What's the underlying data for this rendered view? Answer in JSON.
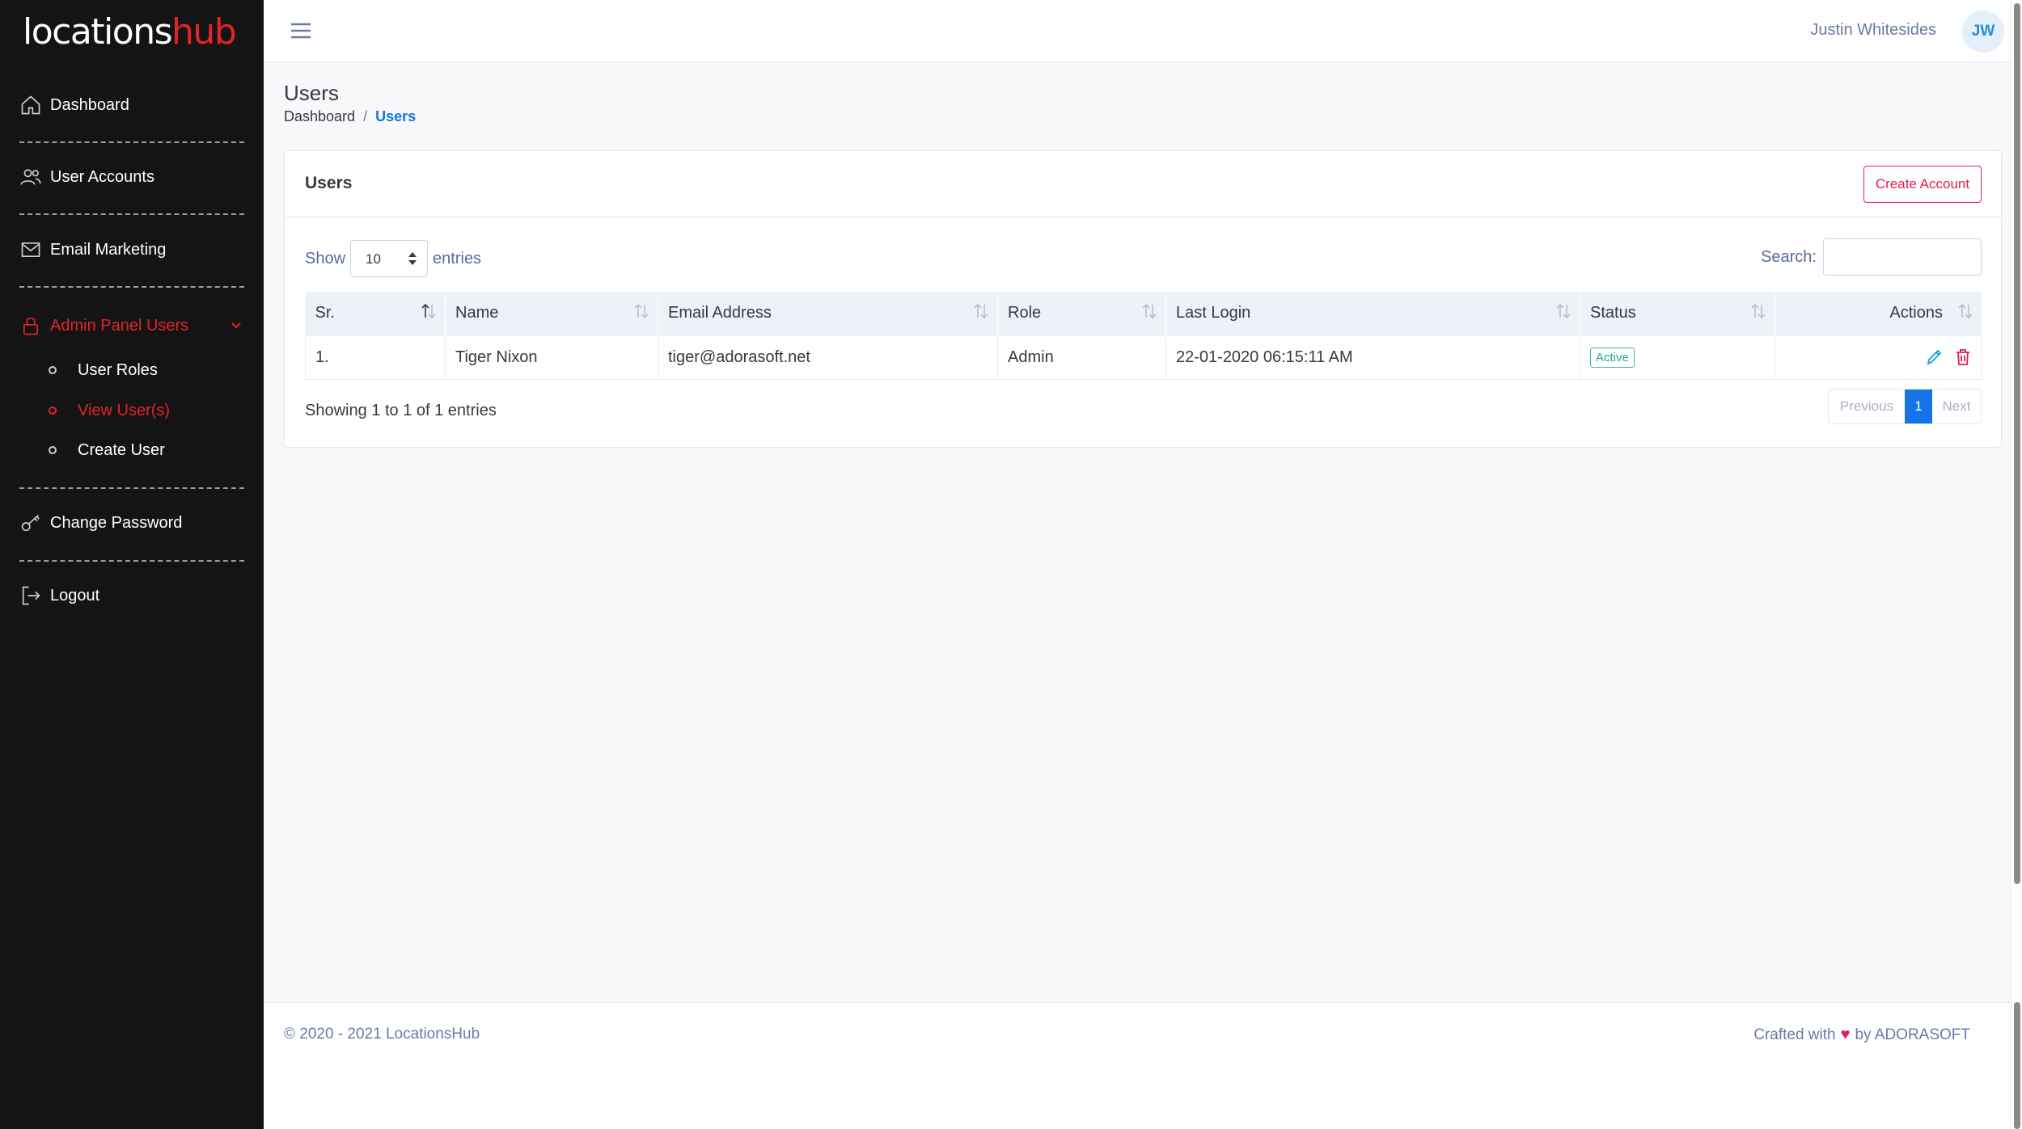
{
  "brand": {
    "part1": "locations",
    "part2": "hub"
  },
  "sidebar": {
    "items": [
      {
        "label": "Dashboard"
      },
      {
        "label": "User Accounts"
      },
      {
        "label": "Email Marketing"
      },
      {
        "label": "Admin Panel Users"
      },
      {
        "label": "Change Password"
      },
      {
        "label": "Logout"
      }
    ],
    "sub_items": [
      {
        "label": "User Roles"
      },
      {
        "label": "View User(s)"
      },
      {
        "label": "Create User"
      }
    ]
  },
  "topbar": {
    "user_name": "Justin Whitesides",
    "avatar_initials": "JW"
  },
  "page": {
    "title": "Users",
    "breadcrumb": {
      "home": "Dashboard",
      "separator": "/",
      "current": "Users"
    }
  },
  "card": {
    "title": "Users",
    "create_button": "Create Account",
    "show_label": "Show",
    "entries_label": "entries",
    "page_length": "10",
    "search_label": "Search:",
    "search_value": "",
    "columns": [
      "Sr.",
      "Name",
      "Email Address",
      "Role",
      "Last Login",
      "Status",
      "Actions"
    ],
    "rows": [
      {
        "sr": "1.",
        "name": "Tiger Nixon",
        "email": "tiger@adorasoft.net",
        "role": "Admin",
        "last_login": "22-01-2020 06:15:11 AM",
        "status": "Active"
      }
    ],
    "info": "Showing 1 to 1 of 1 entries",
    "pagination": {
      "previous": "Previous",
      "current": "1",
      "next": "Next"
    }
  },
  "footer": {
    "copyright": "© 2020 - 2021 LocationsHub",
    "crafted_prefix": "Crafted with",
    "heart": "♥",
    "crafted_suffix": "by ADORASOFT"
  },
  "colors": {
    "accent": "#e0242a",
    "primary": "#1573e6",
    "success": "#34c38f",
    "danger": "#e31e50"
  },
  "icons": [
    "menu-icon",
    "home-icon",
    "users-icon",
    "mail-icon",
    "lock-icon",
    "chevron-down-icon",
    "key-icon",
    "logout-icon",
    "sort-icon",
    "edit-icon",
    "trash-icon",
    "heart-icon"
  ]
}
